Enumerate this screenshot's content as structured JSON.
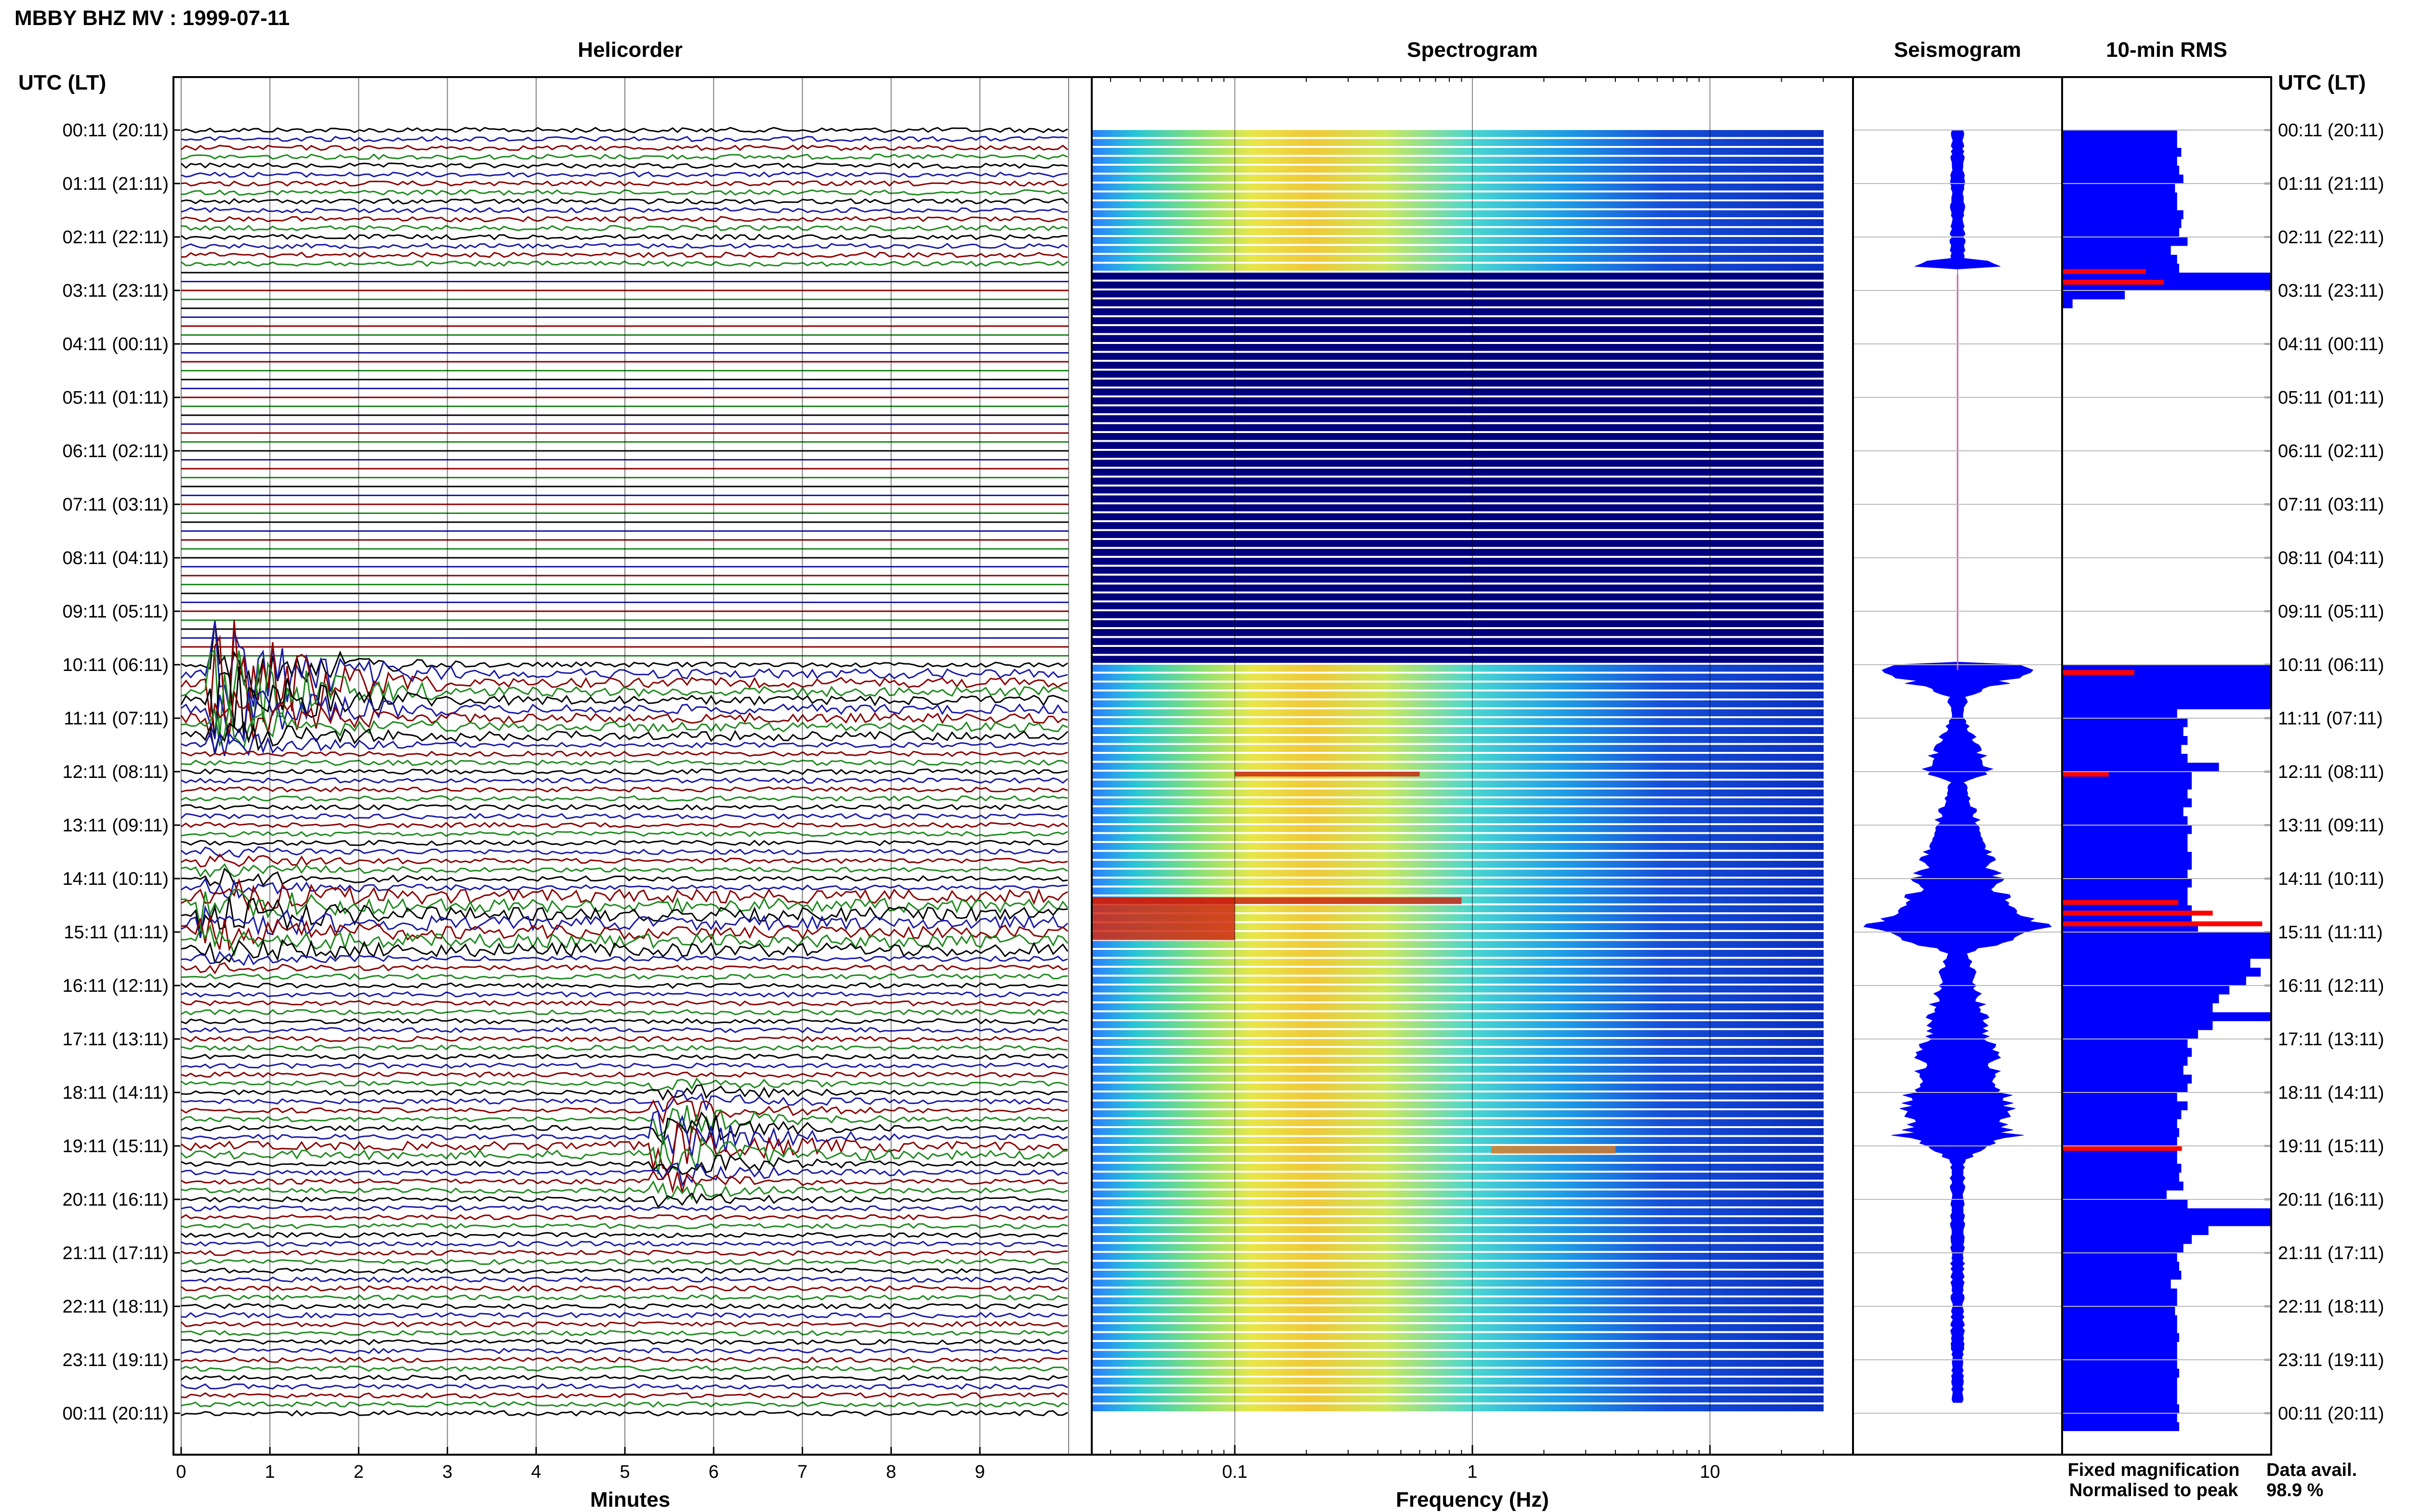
{
  "figure": {
    "title": "MBBY BHZ MV : 1999-07-11",
    "time_axis_label": "UTC (LT)",
    "panels": {
      "helicorder": "Helicorder",
      "spectrogram": "Spectrogram",
      "seismogram": "Seismogram",
      "rms": "10-min RMS"
    },
    "legend": {
      "fixed": "Fixed magnification",
      "normalised": "Normalised to peak",
      "fixed_color": "#1a1aff",
      "normalised_color": "#e01010"
    },
    "data_availability": {
      "label": "Data avail.",
      "value": "98.9 %"
    },
    "colors": {
      "helicorder_traces": [
        "#000000",
        "#1a1aa8",
        "#8b0000",
        "#1f8a1f"
      ],
      "spectrogram_gap": "#00007f",
      "rms_bar": "#0000ff",
      "rms_peak": "#ff0000"
    }
  },
  "chart_data": [
    {
      "type": "line",
      "name": "helicorder",
      "title": "Helicorder",
      "xlabel": "Minutes",
      "x_ticks": [
        "0",
        "1",
        "2",
        "3",
        "4",
        "5",
        "6",
        "7",
        "8",
        "9"
      ],
      "xlim": [
        0,
        10
      ],
      "y_ticks": [
        "00:11 (20:11)",
        "01:11 (21:11)",
        "02:11 (22:11)",
        "03:11 (23:11)",
        "04:11 (00:11)",
        "05:11 (01:11)",
        "06:11 (02:11)",
        "07:11 (03:11)",
        "08:11 (04:11)",
        "09:11 (05:11)",
        "10:11 (06:11)",
        "11:11 (07:11)",
        "12:11 (08:11)",
        "13:11 (09:11)",
        "14:11 (10:11)",
        "15:11 (11:11)",
        "16:11 (12:11)",
        "17:11 (13:11)",
        "18:11 (14:11)",
        "19:11 (15:11)",
        "20:11 (16:11)",
        "21:11 (17:11)",
        "22:11 (18:11)",
        "23:11 (19:11)",
        "00:11 (20:11)"
      ],
      "rows_per_hour": 6,
      "data_gap_hours": [
        2.55,
        10.0
      ],
      "events_minutes_hours": [
        {
          "t_hour": 10.3,
          "minute": 0.6,
          "amplitude": 10
        },
        {
          "t_hour": 14.6,
          "minute": 0.5,
          "amplitude": 3
        },
        {
          "t_hour": 18.9,
          "minute": 5.6,
          "amplitude": 4
        }
      ]
    },
    {
      "type": "heatmap",
      "name": "spectrogram",
      "title": "Spectrogram",
      "xlabel": "Frequency (Hz)",
      "x_scale": "log",
      "xlim": [
        0.025,
        40
      ],
      "x_ticks": [
        "0.1",
        "1",
        "10"
      ],
      "x_tick_values": [
        0.1,
        1,
        10
      ],
      "peak_frequency_hz": 0.3,
      "gap_hours": [
        2.55,
        10.0
      ]
    },
    {
      "type": "area",
      "name": "seismogram",
      "title": "Seismogram",
      "envelope_hours": [
        0,
        2.4,
        2.5,
        2.6,
        2.8,
        10.2,
        10.6,
        11.0,
        12.0,
        12.2,
        14.4,
        14.9,
        15.4,
        18.8,
        19.0,
        19.3,
        23.8
      ],
      "envelope_halfwidth": [
        0.06,
        0.07,
        0.5,
        0.6,
        0.1,
        0.7,
        0.1,
        0.07,
        0.35,
        0.08,
        0.5,
        0.9,
        0.12,
        0.6,
        0.3,
        0.07,
        0.06
      ]
    },
    {
      "type": "bar",
      "name": "10-min RMS",
      "title": "10-min RMS",
      "y_ticks": [
        "00:11 (20:11)",
        "01:11 (21:11)",
        "02:11 (22:11)",
        "03:11 (23:11)",
        "04:11 (00:11)",
        "05:11 (01:11)",
        "06:11 (02:11)",
        "07:11 (03:11)",
        "08:11 (04:11)",
        "09:11 (05:11)",
        "10:11 (06:11)",
        "11:11 (07:11)",
        "12:11 (08:11)",
        "13:11 (09:11)",
        "14:11 (10:11)",
        "15:11 (11:11)",
        "16:11 (12:11)",
        "17:11 (13:11)",
        "18:11 (14:11)",
        "19:11 (15:11)",
        "20:11 (16:11)",
        "21:11 (17:11)",
        "22:11 (18:11)",
        "23:11 (19:11)",
        "00:11 (20:11)"
      ],
      "interval_minutes": 10,
      "values": [
        0.55,
        0.55,
        0.57,
        0.55,
        0.56,
        0.58,
        0.54,
        0.55,
        0.55,
        0.58,
        0.57,
        0.56,
        0.6,
        0.52,
        0.55,
        0.56,
        1.0,
        1.0,
        0.3,
        0.05,
        0,
        0,
        0,
        0,
        0,
        0,
        0,
        0,
        0,
        0,
        0,
        0,
        0,
        0,
        0,
        0,
        0,
        0,
        0,
        0,
        0,
        0,
        0,
        0,
        0,
        0,
        0,
        0,
        0,
        0,
        0,
        0,
        0,
        0,
        0,
        0,
        0,
        0,
        0,
        0,
        1.0,
        1.0,
        1.0,
        1.0,
        1.0,
        0.55,
        0.6,
        0.58,
        0.6,
        0.57,
        0.6,
        0.75,
        0.62,
        0.62,
        0.6,
        0.62,
        0.58,
        0.6,
        0.62,
        0.6,
        0.6,
        0.62,
        0.62,
        0.6,
        0.62,
        0.6,
        0.6,
        0.62,
        0.62,
        0.65,
        1.0,
        1.0,
        1.0,
        0.9,
        0.95,
        0.88,
        0.8,
        0.75,
        0.72,
        1.0,
        0.72,
        0.65,
        0.6,
        0.62,
        0.6,
        0.58,
        0.62,
        0.6,
        0.55,
        0.6,
        0.57,
        0.55,
        0.56,
        0.55,
        0.55,
        0.55,
        0.57,
        0.56,
        0.58,
        0.5,
        0.6,
        1.0,
        1.0,
        0.7,
        0.62,
        0.58,
        0.55,
        0.56,
        0.57,
        0.52,
        0.55,
        0.55,
        0.54,
        0.55,
        0.55,
        0.56,
        0.55,
        0.55,
        0.55,
        0.56,
        0.55,
        0.55,
        0.55,
        0.56,
        0.55,
        0.56
      ],
      "peak_flag_hours": [
        2.6,
        2.8,
        10.1,
        12.0,
        14.4,
        14.6,
        14.8,
        19.0
      ],
      "xlim": [
        0,
        1
      ]
    }
  ]
}
